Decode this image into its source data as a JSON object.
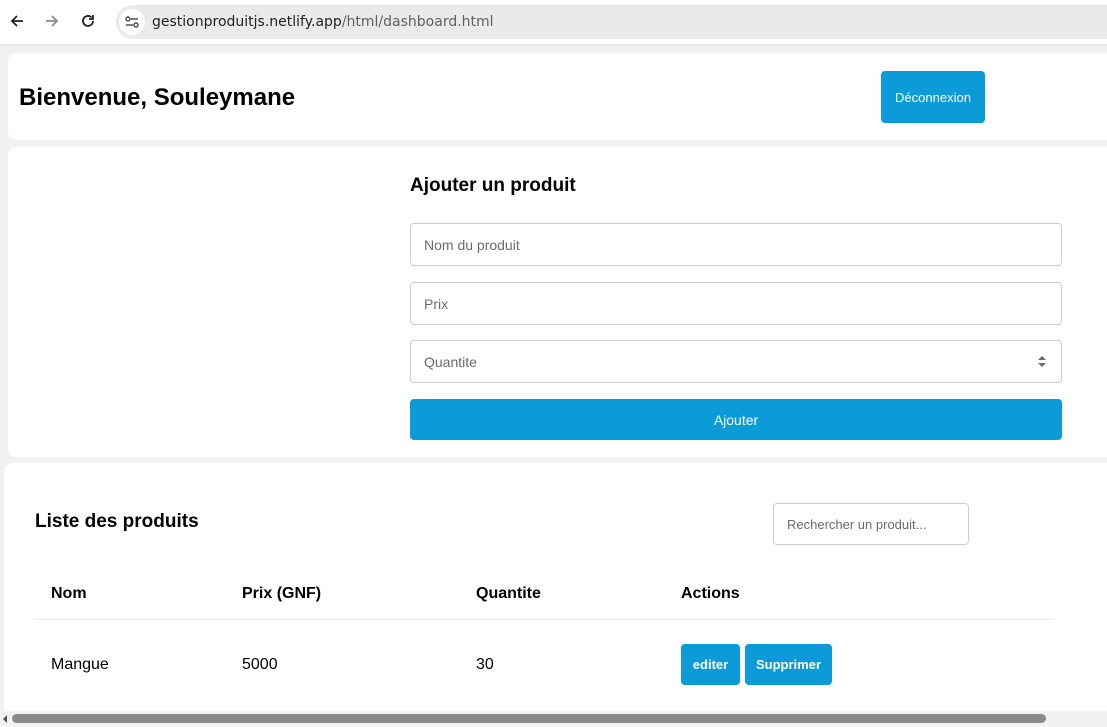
{
  "browser": {
    "url_domain": "gestionproduitjs.netlify.app",
    "url_path": "/html/dashboard.html",
    "icons": [
      "back-arrow-icon",
      "forward-arrow-icon",
      "reload-icon",
      "site-info-icon"
    ]
  },
  "header": {
    "welcome": "Bienvenue, Souleymane",
    "logout_label": "Déconnexion"
  },
  "form": {
    "title": "Ajouter un produit",
    "name_placeholder": "Nom du produit",
    "price_placeholder": "Prix",
    "quantity_placeholder": "Quantite",
    "submit_label": "Ajouter"
  },
  "list": {
    "title": "Liste des produits",
    "search_placeholder": "Rechercher un produit...",
    "columns": [
      "Nom",
      "Prix (GNF)",
      "Quantite",
      "Actions"
    ],
    "rows": [
      {
        "name": "Mangue",
        "price": "5000",
        "quantity": "30",
        "edit_label": "editer",
        "delete_label": "Supprimer"
      }
    ]
  },
  "colors": {
    "accent": "#0a9bd8",
    "background": "#f1f1f1",
    "card": "#ffffff"
  }
}
